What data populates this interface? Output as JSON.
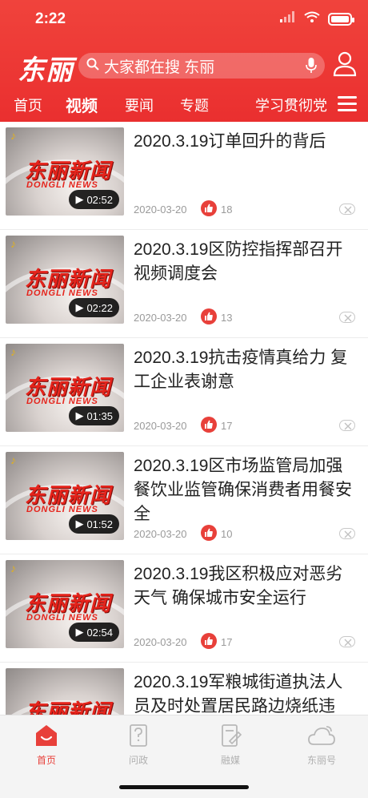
{
  "status": {
    "time": "2:22"
  },
  "header": {
    "logo": "东丽",
    "search_placeholder": "大家都在搜 东丽"
  },
  "tabs": [
    {
      "label": "首页",
      "active": false
    },
    {
      "label": "视频",
      "active": true
    },
    {
      "label": "要闻",
      "active": false
    },
    {
      "label": "专题",
      "active": false
    },
    {
      "label": "学习贯彻党",
      "active": false
    }
  ],
  "thumb": {
    "brand_cn": "东丽新闻",
    "brand_en": "DONGLI NEWS"
  },
  "items": [
    {
      "title": "2020.3.19订单回升的背后",
      "date": "2020-03-20",
      "likes": "18",
      "duration": "02:52"
    },
    {
      "title": "2020.3.19区防控指挥部召开视频调度会",
      "date": "2020-03-20",
      "likes": "13",
      "duration": "02:22"
    },
    {
      "title": "2020.3.19抗击疫情真给力 复工企业表谢意",
      "date": "2020-03-20",
      "likes": "17",
      "duration": "01:35"
    },
    {
      "title": "2020.3.19区市场监管局加强餐饮业监管确保消费者用餐安全",
      "date": "2020-03-20",
      "likes": "10",
      "duration": "01:52"
    },
    {
      "title": "2020.3.19我区积极应对恶劣天气 确保城市安全运行",
      "date": "2020-03-20",
      "likes": "17",
      "duration": "02:54"
    },
    {
      "title": "2020.3.19军粮城街道执法人员及时处置居民路边烧纸违",
      "date": "",
      "likes": "",
      "duration": ""
    }
  ],
  "bottom_nav": [
    {
      "label": "首页",
      "icon": "home-icon",
      "active": true
    },
    {
      "label": "问政",
      "icon": "question-doc-icon",
      "active": false
    },
    {
      "label": "融媒",
      "icon": "media-doc-icon",
      "active": false
    },
    {
      "label": "东丽号",
      "icon": "cloud-icon",
      "active": false
    }
  ],
  "colors": {
    "brand_red": "#e8403a",
    "header_red": "#ef3b36"
  }
}
